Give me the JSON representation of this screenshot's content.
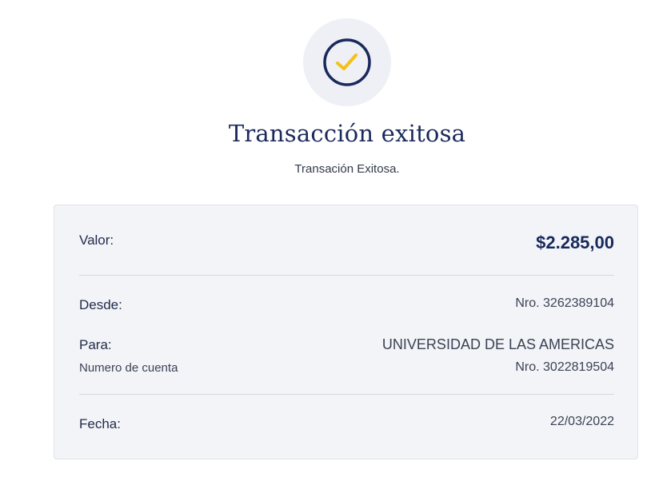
{
  "header": {
    "status_icon": "check-icon",
    "title": "Transacción exitosa",
    "subtitle": "Transación Exitosa."
  },
  "colors": {
    "accent_navy": "#1a2a5c",
    "check_yellow": "#f5c116",
    "icon_background": "#eef0f5",
    "card_background": "#f3f4f7"
  },
  "details": {
    "valor": {
      "label": "Valor:",
      "value": "$2.285,00"
    },
    "desde": {
      "label": "Desde:",
      "value": "Nro. 3262389104"
    },
    "para": {
      "label": "Para:",
      "value": "UNIVERSIDAD DE LAS AMERICAS",
      "sub_label": "Numero de cuenta",
      "sub_value": "Nro. 3022819504"
    },
    "fecha": {
      "label": "Fecha:",
      "value": "22/03/2022"
    }
  }
}
